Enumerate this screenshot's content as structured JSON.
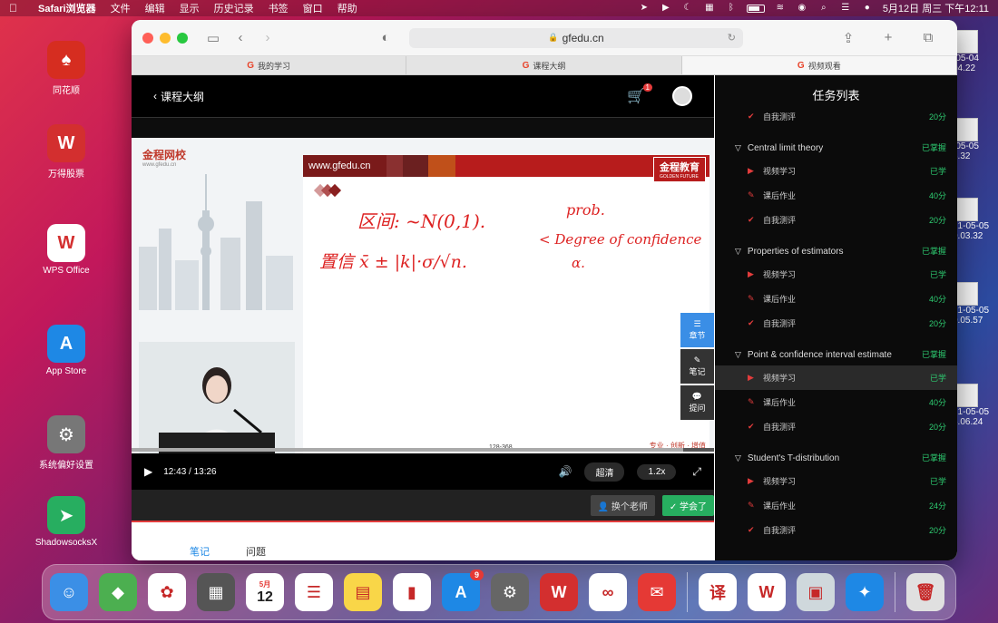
{
  "menubar": {
    "app": "Safari浏览器",
    "items": [
      "文件",
      "编辑",
      "显示",
      "历史记录",
      "书签",
      "窗口",
      "帮助"
    ],
    "datetime": "5月12日 周三 下午12:11"
  },
  "desktop": {
    "icons": [
      {
        "label": "同花顺",
        "color": "#d62d20",
        "glyph": "♠"
      },
      {
        "label": "万得股票",
        "color": "#d32f2f",
        "glyph": "W"
      },
      {
        "label": "WPS Office",
        "color": "#ffffff",
        "glyph": "W"
      },
      {
        "label": "App Store",
        "color": "#1e88e5",
        "glyph": "A"
      },
      {
        "label": "系统偏好设置",
        "color": "#777777",
        "glyph": "⚙"
      },
      {
        "label": "ShadowsocksX",
        "color": "#27ae60",
        "glyph": "➤"
      }
    ],
    "thumbs": [
      "-05-04 04.22",
      "-05-05 3.32",
      "21-05-05 0.03.32",
      "21-05-05 0.05.57",
      "21-05-05 5.06.24"
    ]
  },
  "safari": {
    "url": "gfedu.cn",
    "tabs": [
      {
        "label": "我的学习"
      },
      {
        "label": "课程大纲"
      },
      {
        "label": "视频观看"
      }
    ]
  },
  "player": {
    "back_label": "课程大纲",
    "cart_count": "1",
    "brand": "金程网校",
    "brand_sub": "www.gfedu.cn",
    "slide_url": "www.gfedu.cn",
    "slide_logo": "金程教育",
    "slide_logo_sub": "GOLDEN FUTURE",
    "slide_page": "128-368",
    "slide_footer": "专业 · 创新 · 增值",
    "handwriting": {
      "line1": "区间: ~N(0,1).",
      "line2": "置信 x̄ ± |k|·σ/√n.",
      "prob": "prob.",
      "doc": "< Degree of confidence",
      "alpha": "α."
    },
    "time": "12:43 / 13:26",
    "progress": 0.947,
    "quality": "超清",
    "speed": "1.2x",
    "btn_change_teacher": "换个老师",
    "btn_learned": "学会了",
    "note_tabs": [
      "笔记",
      "问题"
    ],
    "side_tools": [
      "章节",
      "笔记",
      "提问"
    ]
  },
  "tasks": {
    "title": "任务列表",
    "rows": [
      {
        "type": "item",
        "kind": "quiz",
        "label": "自我测评",
        "status": "20分"
      },
      {
        "type": "section",
        "label": "Central limit theory",
        "status": "已掌握"
      },
      {
        "type": "item",
        "kind": "video",
        "label": "视频学习",
        "status": "已学"
      },
      {
        "type": "item",
        "kind": "homework",
        "label": "课后作业",
        "status": "40分"
      },
      {
        "type": "item",
        "kind": "quiz",
        "label": "自我测评",
        "status": "20分"
      },
      {
        "type": "section",
        "label": "Properties of estimators",
        "status": "已掌握"
      },
      {
        "type": "item",
        "kind": "video",
        "label": "视频学习",
        "status": "已学"
      },
      {
        "type": "item",
        "kind": "homework",
        "label": "课后作业",
        "status": "40分"
      },
      {
        "type": "item",
        "kind": "quiz",
        "label": "自我测评",
        "status": "20分"
      },
      {
        "type": "section",
        "label": "Point & confidence interval estimate",
        "status": "已掌握"
      },
      {
        "type": "item",
        "kind": "video",
        "label": "视频学习",
        "status": "已学",
        "active": true
      },
      {
        "type": "item",
        "kind": "homework",
        "label": "课后作业",
        "status": "40分"
      },
      {
        "type": "item",
        "kind": "quiz",
        "label": "自我测评",
        "status": "20分"
      },
      {
        "type": "section",
        "label": "Student's T-distribution",
        "status": "已掌握"
      },
      {
        "type": "item",
        "kind": "video",
        "label": "视频学习",
        "status": "已学"
      },
      {
        "type": "item",
        "kind": "homework",
        "label": "课后作业",
        "status": "24分"
      },
      {
        "type": "item",
        "kind": "quiz",
        "label": "自我测评",
        "status": "20分"
      }
    ]
  },
  "dock": {
    "apps": [
      {
        "name": "finder",
        "color": "#3b8fe6",
        "glyph": "☺"
      },
      {
        "name": "maps",
        "color": "#4caf50",
        "glyph": "◆"
      },
      {
        "name": "photos",
        "color": "#ffffff",
        "glyph": "✿"
      },
      {
        "name": "launchpad",
        "color": "#555555",
        "glyph": "▦"
      },
      {
        "name": "calendar",
        "color": "#ffffff",
        "glyph": "12"
      },
      {
        "name": "reminders",
        "color": "#ffffff",
        "glyph": "☰"
      },
      {
        "name": "notes",
        "color": "#f9d648",
        "glyph": "▤"
      },
      {
        "name": "numbers",
        "color": "#ffffff",
        "glyph": "▮"
      },
      {
        "name": "app-store",
        "color": "#1e88e5",
        "glyph": "A",
        "badge": "9"
      },
      {
        "name": "system-preferences",
        "color": "#666666",
        "glyph": "⚙"
      },
      {
        "name": "wind",
        "color": "#d32f2f",
        "glyph": "W"
      },
      {
        "name": "tencent-meeting",
        "color": "#ffffff",
        "glyph": "∞"
      },
      {
        "name": "mail",
        "color": "#e53935",
        "glyph": "✉"
      },
      {
        "name": "translator",
        "color": "#ffffff",
        "glyph": "译"
      },
      {
        "name": "wps",
        "color": "#ffffff",
        "glyph": "W"
      },
      {
        "name": "preview",
        "color": "#cfd8dc",
        "glyph": "▣"
      },
      {
        "name": "safari",
        "color": "#1e88e5",
        "glyph": "✦"
      },
      {
        "name": "trash",
        "color": "#e0e0e0",
        "glyph": "🗑"
      }
    ],
    "calendar_month": "5月"
  }
}
